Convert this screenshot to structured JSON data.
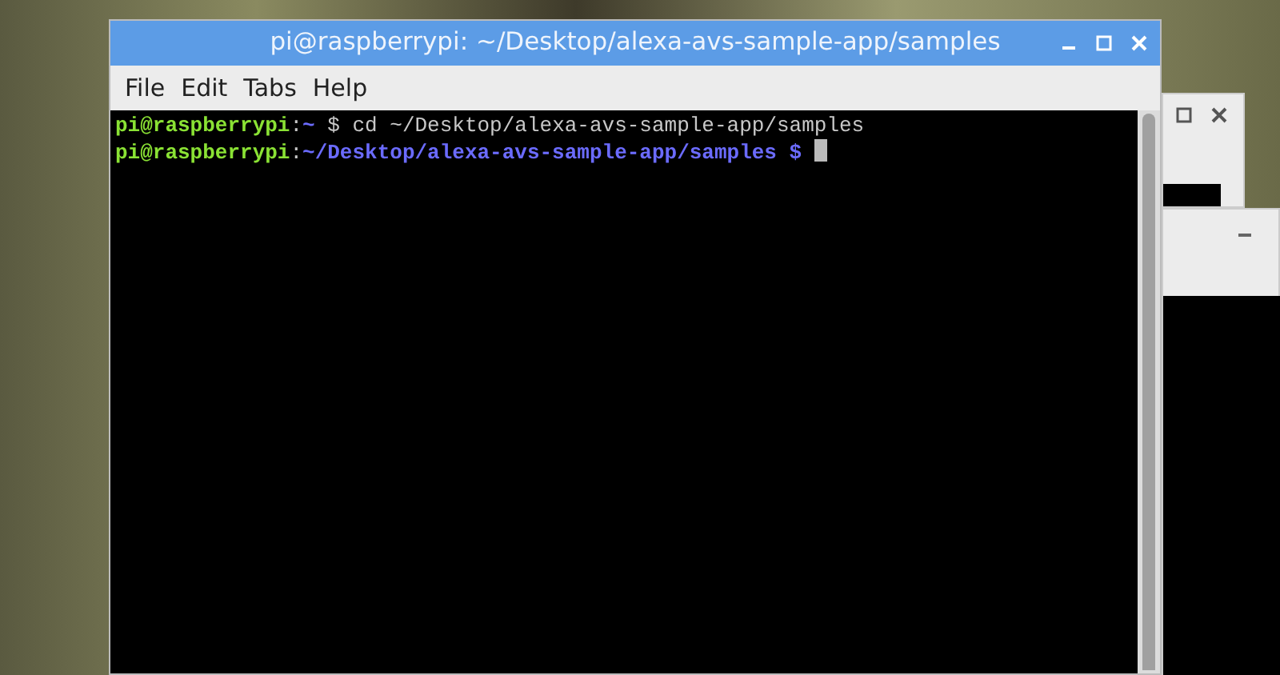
{
  "window": {
    "title": "pi@raspberrypi: ~/Desktop/alexa-avs-sample-app/samples"
  },
  "menu": [
    "File",
    "Edit",
    "Tabs",
    "Help"
  ],
  "terminal": {
    "lines": [
      {
        "segments": [
          {
            "kind": "user",
            "text": "pi@raspberrypi"
          },
          {
            "kind": "plain",
            "text": ":"
          },
          {
            "kind": "path",
            "text": "~"
          },
          {
            "kind": "plain",
            "text": " $ cd ~/Desktop/alexa-avs-sample-app/samples"
          }
        ],
        "cursor": false
      },
      {
        "segments": [
          {
            "kind": "user",
            "text": "pi@raspberrypi"
          },
          {
            "kind": "plain",
            "text": ":"
          },
          {
            "kind": "path",
            "text": "~/Desktop/alexa-avs-sample-app/samples $"
          }
        ],
        "cursor": true
      }
    ]
  }
}
